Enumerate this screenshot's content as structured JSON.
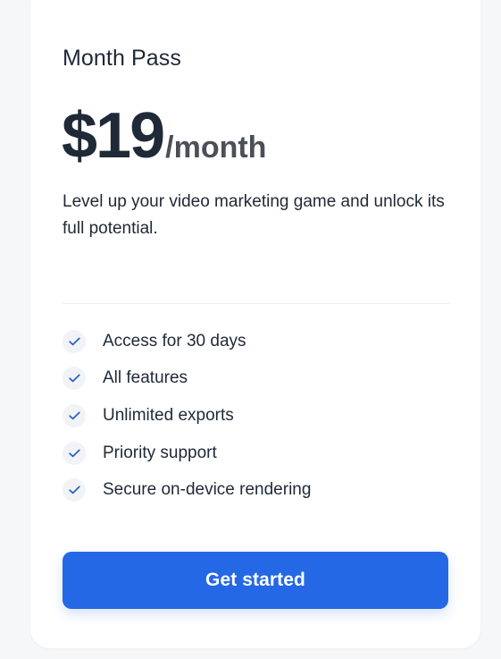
{
  "plan": {
    "name": "Month Pass",
    "price": "$19",
    "period": "/month",
    "description": "Level up your video marketing game and unlock its full potential."
  },
  "features": [
    {
      "label": "Access for 30 days",
      "icon": "check-icon"
    },
    {
      "label": "All features",
      "icon": "check-icon"
    },
    {
      "label": "Unlimited exports",
      "icon": "check-icon"
    },
    {
      "label": "Priority support",
      "icon": "check-icon"
    },
    {
      "label": "Secure on-device rendering",
      "icon": "check-icon"
    }
  ],
  "cta": {
    "label": "Get started"
  },
  "colors": {
    "accent": "#2468e6",
    "check": "#2b5fbf",
    "text": "#1f2937",
    "background": "#f6f7f9",
    "card": "#ffffff"
  }
}
